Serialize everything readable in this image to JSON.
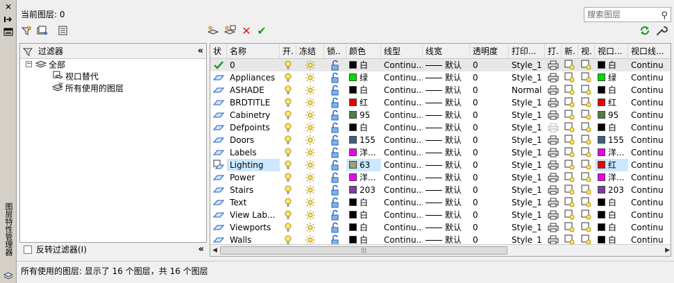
{
  "palette_title": "图层特性管理器",
  "current_layer": "当前图层: 0",
  "search_placeholder": "搜索图层",
  "filter_panel": {
    "header": "过滤器",
    "nodes": [
      {
        "label": "全部",
        "depth": 0
      },
      {
        "label": "视口替代",
        "depth": 1
      },
      {
        "label": "所有使用的图层",
        "depth": 1
      }
    ],
    "invert_label": "反转过滤器(I)"
  },
  "columns": [
    "状",
    "名称",
    "开.",
    "冻结",
    "锁..",
    "颜色",
    "线型",
    "线宽",
    "透明度",
    "打印...",
    "打.",
    "新.",
    "视.",
    "视口...",
    "视口线..."
  ],
  "layers": [
    {
      "name": "0",
      "color_name": "白",
      "color": "#000000",
      "linetype": "Continu...",
      "lineweight": "默认",
      "transparency": "0",
      "plot_style": "Style_1",
      "vp_color_name": "白",
      "vp_color": "#000000",
      "vp_linetype": "Continu",
      "current": true
    },
    {
      "name": "Appliances",
      "color_name": "绿",
      "color": "#00dd00",
      "linetype": "Continu...",
      "lineweight": "默认",
      "transparency": "0",
      "plot_style": "Style_1",
      "vp_color_name": "绿",
      "vp_color": "#00dd00",
      "vp_linetype": "Continu"
    },
    {
      "name": "ASHADE",
      "color_name": "白",
      "color": "#000000",
      "linetype": "Continu...",
      "lineweight": "默认",
      "transparency": "0",
      "plot_style": "Normal",
      "vp_color_name": "白",
      "vp_color": "#000000",
      "vp_linetype": "Continu"
    },
    {
      "name": "BRDTITLE",
      "color_name": "红",
      "color": "#ee0000",
      "linetype": "Continu...",
      "lineweight": "默认",
      "transparency": "0",
      "plot_style": "Style_1",
      "vp_color_name": "红",
      "vp_color": "#ee0000",
      "vp_linetype": "Continu"
    },
    {
      "name": "Cabinetry",
      "color_name": "95",
      "color": "#4f7f3f",
      "linetype": "Continu...",
      "lineweight": "默认",
      "transparency": "0",
      "plot_style": "Style_1",
      "vp_color_name": "95",
      "vp_color": "#4f7f3f",
      "vp_linetype": "Continu"
    },
    {
      "name": "Defpoints",
      "color_name": "白",
      "color": "#000000",
      "linetype": "Continu...",
      "lineweight": "默认",
      "transparency": "0",
      "plot_style": "Style_1",
      "vp_color_name": "白",
      "vp_color": "#000000",
      "vp_linetype": "Continu",
      "no_plot": true
    },
    {
      "name": "Doors",
      "color_name": "155",
      "color": "#3f5f7f",
      "linetype": "Continu...",
      "lineweight": "默认",
      "transparency": "0",
      "plot_style": "Style_1",
      "vp_color_name": "155",
      "vp_color": "#3f5f7f",
      "vp_linetype": "Continu"
    },
    {
      "name": "Labels",
      "color_name": "洋...",
      "color": "#ee00ee",
      "linetype": "Continu...",
      "lineweight": "默认",
      "transparency": "0",
      "plot_style": "Style_1",
      "vp_color_name": "洋...",
      "vp_color": "#ee00ee",
      "vp_linetype": "Continu"
    },
    {
      "name": "Lighting",
      "color_name": "63",
      "color": "#9f9f6f",
      "linetype": "Continu...",
      "lineweight": "默认",
      "transparency": "0",
      "plot_style": "Style_1",
      "vp_color_name": "红",
      "vp_color": "#ee0000",
      "vp_linetype": "Continu",
      "selected": true
    },
    {
      "name": "Power",
      "color_name": "洋...",
      "color": "#ee00ee",
      "linetype": "Continu...",
      "lineweight": "默认",
      "transparency": "0",
      "plot_style": "Style_1",
      "vp_color_name": "洋...",
      "vp_color": "#ee00ee",
      "vp_linetype": "Continu"
    },
    {
      "name": "Stairs",
      "color_name": "203",
      "color": "#7f3f9f",
      "linetype": "Continu...",
      "lineweight": "默认",
      "transparency": "0",
      "plot_style": "Style_1",
      "vp_color_name": "203",
      "vp_color": "#7f3f9f",
      "vp_linetype": "Continu"
    },
    {
      "name": "Text",
      "color_name": "白",
      "color": "#000000",
      "linetype": "Continu...",
      "lineweight": "默认",
      "transparency": "0",
      "plot_style": "Style_1",
      "vp_color_name": "白",
      "vp_color": "#000000",
      "vp_linetype": "Continu"
    },
    {
      "name": "View Lab...",
      "color_name": "白",
      "color": "#000000",
      "linetype": "Continu...",
      "lineweight": "默认",
      "transparency": "0",
      "plot_style": "Style_1",
      "vp_color_name": "白",
      "vp_color": "#000000",
      "vp_linetype": "Continu"
    },
    {
      "name": "Viewports",
      "color_name": "白",
      "color": "#000000",
      "linetype": "Continu...",
      "lineweight": "默认",
      "transparency": "0",
      "plot_style": "Style_1",
      "vp_color_name": "白",
      "vp_color": "#000000",
      "vp_linetype": "Continu"
    },
    {
      "name": "Walls",
      "color_name": "白",
      "color": "#000000",
      "linetype": "Continu...",
      "lineweight": "默认",
      "transparency": "0",
      "plot_style": "Style_1",
      "vp_color_name": "白",
      "vp_color": "#000000",
      "vp_linetype": "Continu"
    }
  ],
  "status_text": "所有使用的图层: 显示了 16 个图层，共 16 个图层"
}
